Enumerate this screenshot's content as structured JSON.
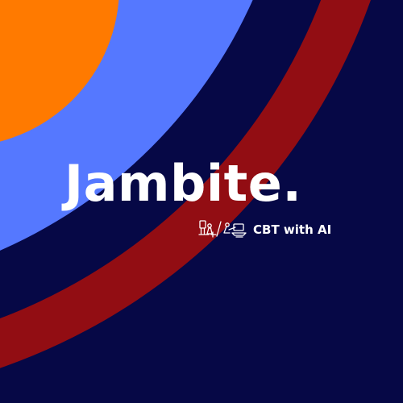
{
  "brand": {
    "wordmark": "Jambite.",
    "tagline": "CBT with AI"
  },
  "colors": {
    "navy_background": "#060846",
    "orange_corner": "#FF7A00",
    "periwinkle_band": "#5578FF",
    "crimson_band": "#920D13",
    "text": "#FFFFFF"
  },
  "icons": {
    "tagline_doodles": "computer-test-doodle-icon"
  }
}
